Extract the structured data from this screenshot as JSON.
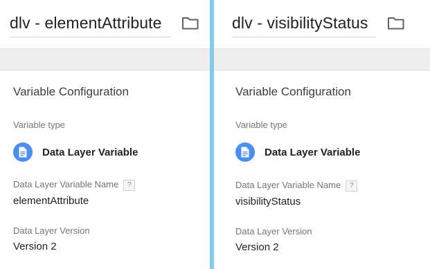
{
  "colors": {
    "divider": "#7fcdea",
    "type_icon_bg": "#4a8ef2",
    "gray_band": "#eeeeee"
  },
  "panels": [
    {
      "title": "dlv - elementAttribute",
      "folder_icon": "folder-icon",
      "section_title": "Variable Configuration",
      "variable_type_label": "Variable type",
      "variable_type": {
        "icon": "document-icon",
        "name": "Data Layer Variable"
      },
      "name_label": "Data Layer Variable Name",
      "help_label": "?",
      "name_value": "elementAttribute",
      "version_label": "Data Layer Version",
      "version_value": "Version 2"
    },
    {
      "title": "dlv - visibilityStatus",
      "folder_icon": "folder-icon",
      "section_title": "Variable Configuration",
      "variable_type_label": "Variable type",
      "variable_type": {
        "icon": "document-icon",
        "name": "Data Layer Variable"
      },
      "name_label": "Data Layer Variable Name",
      "help_label": "?",
      "name_value": "visibilityStatus",
      "version_label": "Data Layer Version",
      "version_value": "Version 2"
    }
  ]
}
